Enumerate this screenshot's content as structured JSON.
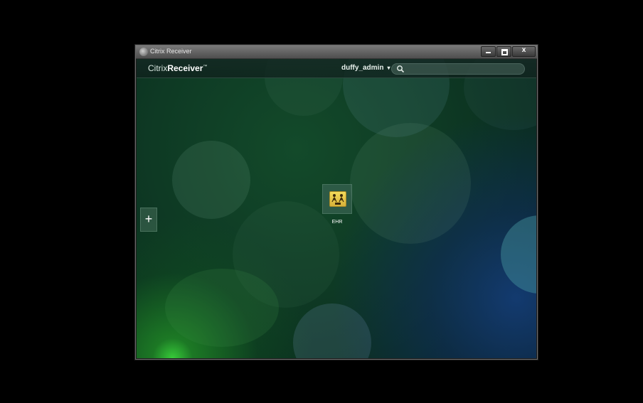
{
  "window": {
    "title": "Citrix Receiver",
    "close_glyph": "x"
  },
  "header": {
    "brand_light": "Citrix",
    "brand_bold": "Receiver",
    "brand_tm": "™",
    "username": "duffy_admin",
    "user_caret": "▾",
    "search_placeholder": ""
  },
  "sidebar": {
    "add_label": "+"
  },
  "apps": [
    {
      "label": "EHR",
      "icon": "ehr-app-icon"
    }
  ],
  "colors": {
    "app_icon": "#e8c94a",
    "header_bg": "#14281f",
    "accent_green": "#3cdc3c"
  }
}
